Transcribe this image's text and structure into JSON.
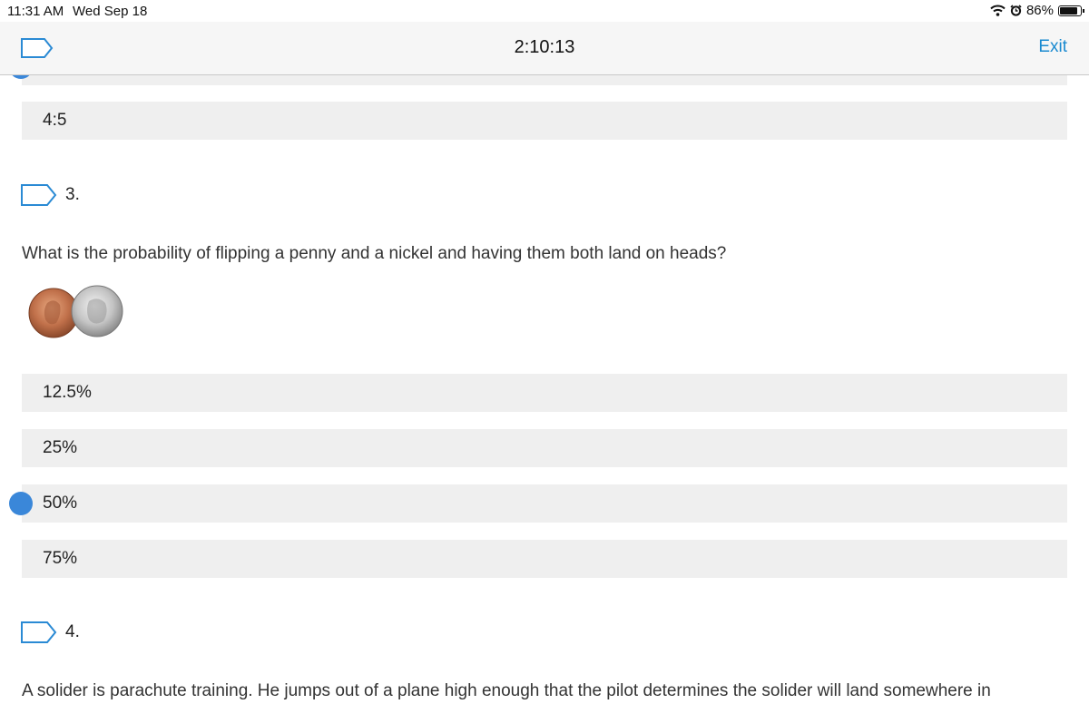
{
  "status_bar": {
    "time": "11:31 AM",
    "date": "Wed Sep 18",
    "battery": "86%"
  },
  "nav": {
    "timer": "2:10:13",
    "exit_label": "Exit"
  },
  "questions": [
    {
      "options": [
        "4:5"
      ]
    },
    {
      "number": "3.",
      "text": "What is the probability of flipping a penny and a nickel and having them both land on heads?",
      "image": "penny-and-nickel-coins",
      "options": [
        "12.5%",
        "25%",
        "50%",
        "75%"
      ],
      "selected": "50%"
    },
    {
      "number": "4.",
      "text": "A solider is parachute training. He jumps out of a plane high enough that the pilot determines the solider will land somewhere in"
    }
  ],
  "colors": {
    "accent": "#3a87d9",
    "link": "#1a8ad0",
    "option_bg": "#efefef",
    "flag_stroke": "#2a8ad4"
  }
}
